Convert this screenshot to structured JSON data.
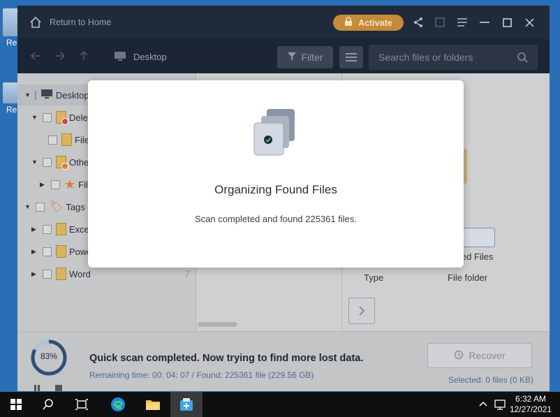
{
  "desktop": {
    "icon_labels": [
      "Rec",
      "Re"
    ]
  },
  "app": {
    "home_label": "Return to Home",
    "activate_label": "Activate",
    "path": "Desktop",
    "filter_label": "Filter",
    "search_placeholder": "Search files or folders",
    "tree": [
      {
        "label": "Desktop",
        "level": 0,
        "expanded": true,
        "selected": true
      },
      {
        "label": "Dele",
        "level": 1,
        "expanded": true
      },
      {
        "label": "File",
        "level": 2
      },
      {
        "label": "Othe",
        "level": 1,
        "expanded": true
      },
      {
        "label": "File",
        "level": 2
      },
      {
        "label": "Tags",
        "level": 0,
        "expanded": true
      },
      {
        "label": "Exce",
        "level": 1
      },
      {
        "label": "Powe",
        "level": 1
      },
      {
        "label": "Word",
        "level": 1,
        "count": "7"
      }
    ],
    "right_panel": {
      "name_suffix": "eted Files",
      "type_label": "Type",
      "type_value": "File folder"
    },
    "status": {
      "progress_percent": 83,
      "progress_label": "83%",
      "title": "Quick scan completed. Now trying to find more lost data.",
      "subtitle": "Remaining time: 00: 04: 07 / Found: 225361 file (229.56 GB)",
      "recover_label": "Recover",
      "selected_text": "Selected: 0 files (0 KB)"
    }
  },
  "modal": {
    "title": "Organizing Found Files",
    "message": "Scan completed and found 225361 files."
  },
  "taskbar": {
    "time": "6:32 AM",
    "date": "12/27/2021"
  },
  "colors": {
    "titlebar": "#1f2a3b",
    "accent": "#c48b3a",
    "progress": "#2f4f7a"
  }
}
